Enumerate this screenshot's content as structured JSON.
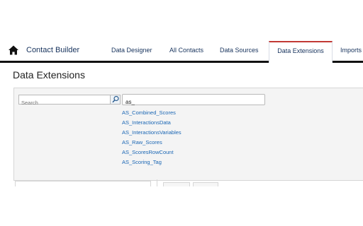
{
  "nav": {
    "home_icon": "home-icon",
    "app_title": "Contact Builder",
    "tabs": [
      {
        "label": "Data Designer",
        "active": false
      },
      {
        "label": "All Contacts",
        "active": false
      },
      {
        "label": "Data Sources",
        "active": false
      },
      {
        "label": "Data Extensions",
        "active": true
      },
      {
        "label": "Imports",
        "active": false
      }
    ],
    "active_tab_color": "#c23934"
  },
  "page": {
    "title": "Data Extensions"
  },
  "search": {
    "placeholder": "Search",
    "icon": "search-icon"
  },
  "query": {
    "value": "as_",
    "suggestions": [
      "AS_Combined_Scores",
      "AS_InteractionsData",
      "AS_InteractionsVariables",
      "AS_Raw_Scores",
      "AS_ScoresRowCount",
      "AS_Scoring_Tag"
    ]
  }
}
